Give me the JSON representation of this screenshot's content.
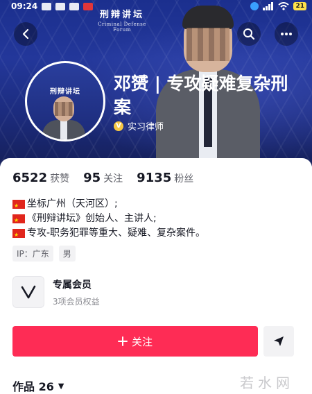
{
  "status_bar": {
    "time": "09:24",
    "battery": "21"
  },
  "banner": {
    "logo_title": "刑辩讲坛",
    "logo_subtitle": "Criminal Defense Forum"
  },
  "avatar": {
    "title": "刑辩讲坛"
  },
  "profile": {
    "name": "邓赟 | 专攻疑难复杂刑案",
    "badge_label": "实习律师"
  },
  "stats": [
    {
      "num": "6522",
      "label": "获赞"
    },
    {
      "num": "95",
      "label": "关注"
    },
    {
      "num": "9135",
      "label": "粉丝"
    }
  ],
  "bio": [
    "坐标广州（天河区）;",
    "《刑辩讲坛》创始人、主讲人;",
    "专攻-职务犯罪等重大、疑难、复杂案件。"
  ],
  "tags": [
    "IP：广东",
    "男"
  ],
  "membership": {
    "title": "专属会员",
    "subtitle": "3项会员权益"
  },
  "actions": {
    "follow_label": "关注"
  },
  "works": {
    "label": "作品 26"
  },
  "watermark": "若水网",
  "colors": {
    "accent": "#fe2c55",
    "banner": "#23379a"
  }
}
